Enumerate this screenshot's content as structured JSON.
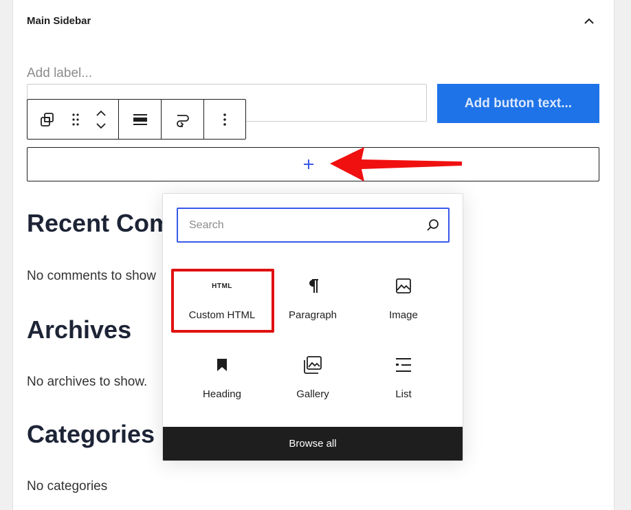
{
  "sidebar": {
    "title": "Main Sidebar"
  },
  "search_widget": {
    "label_placeholder": "Add label...",
    "button_placeholder": "Add button text..."
  },
  "sections": [
    {
      "heading": "Recent Com",
      "text": "No comments to show"
    },
    {
      "heading": "Archives",
      "text": "No archives to show."
    },
    {
      "heading": "Categories",
      "text": "No categories"
    }
  ],
  "inserter": {
    "search_placeholder": "Search",
    "blocks": [
      {
        "label": "Custom HTML",
        "icon": "html-icon",
        "icon_text": "HTML"
      },
      {
        "label": "Paragraph",
        "icon": "paragraph-icon"
      },
      {
        "label": "Image",
        "icon": "image-icon"
      },
      {
        "label": "Heading",
        "icon": "heading-icon"
      },
      {
        "label": "Gallery",
        "icon": "gallery-icon"
      },
      {
        "label": "List",
        "icon": "list-icon"
      }
    ],
    "browse_all": "Browse all"
  },
  "colors": {
    "accent": "#3858e9",
    "button": "#1e73e8",
    "annotation": "#e01010"
  }
}
